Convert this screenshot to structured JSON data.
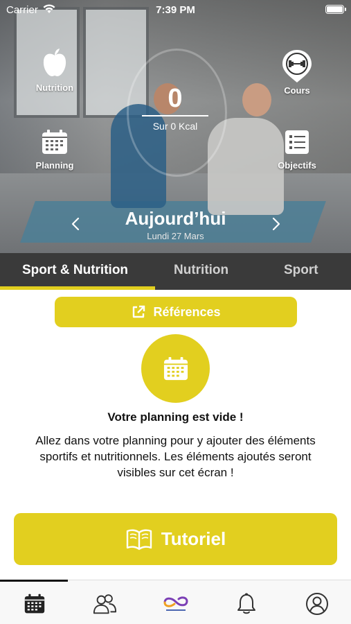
{
  "status_bar": {
    "carrier": "Carrier",
    "time": "7:39 PM"
  },
  "hero": {
    "nutrition_label": "Nutrition",
    "cours_label": "Cours",
    "planning_label": "Planning",
    "objectifs_label": "Objectifs",
    "counter_value": "0",
    "counter_sub": "Sur 0 Kcal",
    "day_title": "Aujourd’hui",
    "day_date": "Lundi 27 Mars"
  },
  "tabs": [
    {
      "label": "Sport & Nutrition",
      "active": true
    },
    {
      "label": "Nutrition",
      "active": false
    },
    {
      "label": "Sport",
      "active": false
    }
  ],
  "references_label": "Références",
  "empty_state": {
    "title": "Votre planning est vide !",
    "text": "Allez dans votre planning pour y ajouter des éléments sportifs et nutritionnels. Les éléments ajoutés seront visibles sur cet écran !"
  },
  "tutoriel_label": "Tutoriel",
  "bottom_nav": {
    "icons": [
      "calendar-icon",
      "users-icon",
      "brand-logo",
      "bell-icon",
      "profile-icon"
    ],
    "active_index": 0
  },
  "colors": {
    "accent": "#E2CF1F",
    "tab_bar": "#3A3A3A",
    "text": "#111111"
  }
}
